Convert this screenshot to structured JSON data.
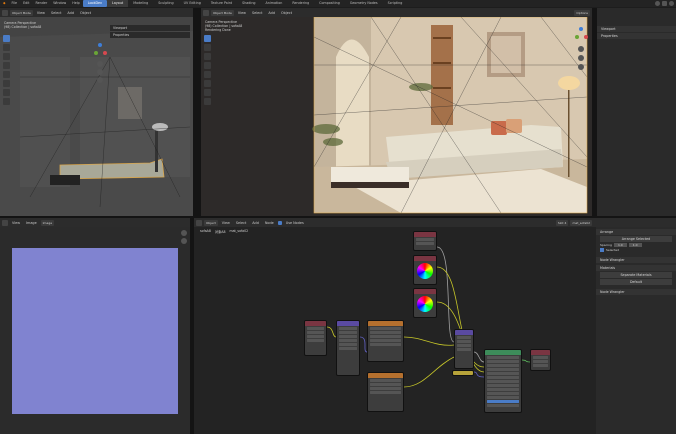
{
  "topbar": {
    "menus": [
      "File",
      "Edit",
      "Render",
      "Window",
      "Help"
    ],
    "workspaces": [
      "Layout",
      "Modeling",
      "Sculpting",
      "UV Editing",
      "Texture Paint",
      "Shading",
      "Animation",
      "Rendering",
      "Compositing",
      "Geometry Nodes",
      "Scripting"
    ],
    "active_workspace": "Layout",
    "current_file_label": "LookDev"
  },
  "viewport_left": {
    "mode": "Object Mode",
    "menus": [
      "View",
      "Select",
      "Add",
      "Object"
    ],
    "info_lines": [
      "Camera Perspective",
      "(98) Collection | sofaA8"
    ],
    "overlay_dropdowns": [
      "Viewport",
      "Properties"
    ],
    "options_label": "Options"
  },
  "viewport_main": {
    "mode": "Object Mode",
    "menus": [
      "View",
      "Select",
      "Add",
      "Object"
    ],
    "info_lines": [
      "Camera Perspective",
      "(98) Collection | sofaA8",
      "Rendering Done"
    ],
    "options_label": "Options"
  },
  "outliner_right": {
    "items": [
      "Viewport",
      "Properties"
    ]
  },
  "image_editor": {
    "menus": [
      "View",
      "Image"
    ],
    "image_name": "Image"
  },
  "node_editor": {
    "menus": [
      "Object",
      "View",
      "Select",
      "Add",
      "Node"
    ],
    "use_nodes_label": "Use Nodes",
    "slot": "Slot 4",
    "material": "mat_sofa02",
    "breadcrumb": [
      "sofaA8",
      "对象A8",
      "mat_sofa02"
    ]
  },
  "node_sidebar": {
    "sections": [
      {
        "title": "Arrange",
        "items": [
          "Arrange Selected",
          "Spacing",
          "Selected"
        ],
        "values": [
          "1.0",
          "1.0"
        ]
      },
      {
        "title": "Node Wrangler",
        "items": []
      },
      {
        "title": "Materials",
        "items": [
          "Separate Materials"
        ],
        "values": [
          "Default"
        ]
      },
      {
        "title": "Node Wrangler",
        "items": []
      }
    ]
  },
  "colors": {
    "accent": "#4a7cc7",
    "normal_map": "#8083d0",
    "panel": "#2c2c2c",
    "node_editor_bg": "#232323",
    "header_shader": "#3d8c5a",
    "header_texture": "#b5702e",
    "header_input": "#7a3542",
    "header_vector": "#5a4aa1"
  }
}
